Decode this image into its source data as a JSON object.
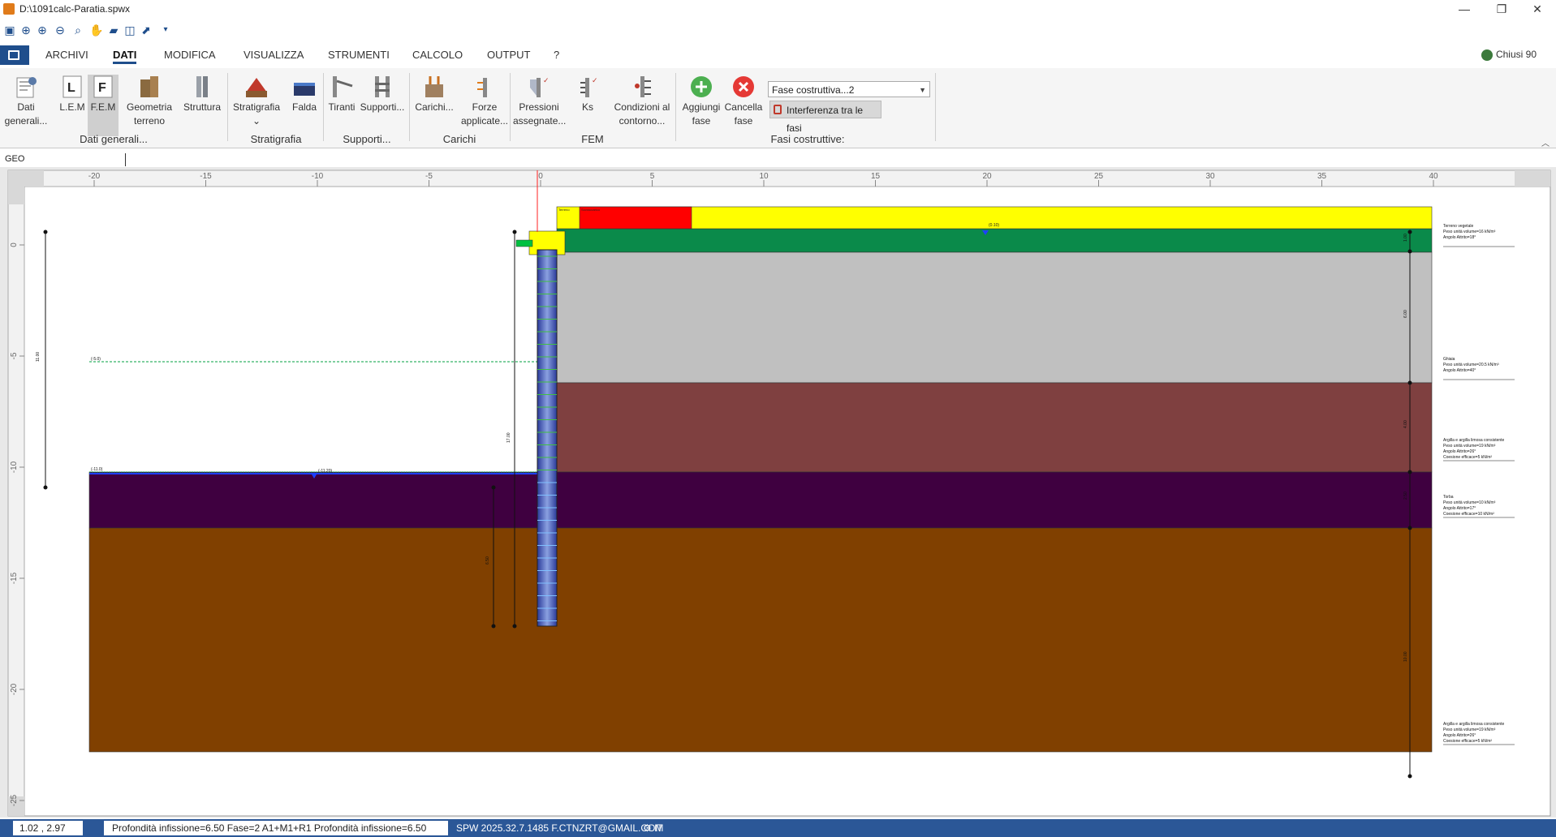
{
  "window": {
    "title": "D:\\1091calc-Paratia.spwx",
    "min_glyph": "—",
    "max_glyph": "❐",
    "close_glyph": "✕"
  },
  "menu": {
    "tabs": [
      "ARCHIVI",
      "DATI",
      "MODIFICA",
      "VISUALIZZA",
      "STRUMENTI",
      "CALCOLO",
      "OUTPUT",
      "?"
    ],
    "active": "DATI",
    "user": "Chiusi 90"
  },
  "ribbon": {
    "buttons": [
      {
        "line1": "Dati",
        "line2": "generali...",
        "icon": "general-data-icon"
      },
      {
        "line1": "L.E.M",
        "line2": "",
        "icon": "lem-icon"
      },
      {
        "line1": "F.E.M",
        "line2": "",
        "icon": "fem-icon"
      },
      {
        "line1": "Geometria",
        "line2": "terreno",
        "icon": "terrain-geometry-icon"
      },
      {
        "line1": "Struttura",
        "line2": "",
        "icon": "structure-icon"
      },
      {
        "line1": "Stratigrafia",
        "line2": "⌄",
        "icon": "stratigraphy-icon"
      },
      {
        "line1": "Falda",
        "line2": "",
        "icon": "water-table-icon"
      },
      {
        "line1": "Tiranti",
        "line2": "",
        "icon": "anchor-icon"
      },
      {
        "line1": "Supporti...",
        "line2": "",
        "icon": "supports-icon"
      },
      {
        "line1": "Carichi...",
        "line2": "",
        "icon": "loads-icon"
      },
      {
        "line1": "Forze",
        "line2": "applicate...",
        "icon": "forces-icon"
      },
      {
        "line1": "Pressioni",
        "line2": "assegnate...",
        "icon": "pressures-icon"
      },
      {
        "line1": "Ks",
        "line2": "",
        "icon": "ks-icon"
      },
      {
        "line1": "Condizioni al",
        "line2": "contorno...",
        "icon": "boundary-conditions-icon"
      },
      {
        "line1": "Aggiungi",
        "line2": "fase",
        "icon": "add-phase-icon"
      },
      {
        "line1": "Cancella",
        "line2": "fase",
        "icon": "delete-phase-icon"
      }
    ],
    "groups": [
      "Dati generali...",
      "Stratigrafia",
      "Supporti...",
      "Carichi",
      "FEM",
      "Fasi costruttive:"
    ],
    "phase_select": "Fase costruttiva...2",
    "interference_label": "Interferenza tra le fasi"
  },
  "geo_tab": "GEO",
  "drawing": {
    "top_ticks": [
      "-20",
      "-15",
      "-10",
      "-5",
      "0",
      "5",
      "10",
      "15",
      "20",
      "25",
      "30",
      "35",
      "40"
    ],
    "left_ticks": [
      "0",
      "-5",
      "-10",
      "-15",
      "-20",
      "-25"
    ],
    "top_soil_labels": [
      "Terreno",
      "Sovraccarico"
    ],
    "water_level_label": "(0.10)",
    "excavation_label": "(-5.0)",
    "excavation_bottom_label": "(-11.0)",
    "excavation_water_label": "(-11.20)",
    "left_dim_label": "11.00",
    "wall_dims": [
      "17.00",
      "6.50"
    ],
    "right_dims": [
      "1.00",
      "6.00",
      "4.00",
      "2.50",
      "10.00"
    ],
    "layers": [
      {
        "name": "Terreno vegetale",
        "lines": [
          "Terreno vegetale",
          "Peso unità volume=16 kN/m³",
          "Angolo Attrito=18°"
        ],
        "color": "#0a8a4a"
      },
      {
        "name": "Ghiaia",
        "lines": [
          "Ghiaia",
          "Peso unità volume=20.5 kN/m³",
          "Angolo Attrito=40°"
        ],
        "color": "#c0c0c0"
      },
      {
        "name": "Argilla",
        "lines": [
          "Argilla e argilla limosa consistente",
          "Peso unità volume=19 kN/m³",
          "Angolo Attrito=26°",
          "Coesione efficace=5 kN/m²"
        ],
        "color": "#7f4040"
      },
      {
        "name": "Torba",
        "lines": [
          "Torba",
          "Peso unità volume=10 kN/m³",
          "Angolo Attrito=17°",
          "Coesione efficace=10 kN/m²"
        ],
        "color": "#3f0040"
      },
      {
        "name": "Argilla2",
        "lines": [
          "Argilla e argilla limosa consistente",
          "Peso unità volume=19 kN/m³",
          "Angolo Attrito=26°",
          "Coesione efficace=5 kN/m²"
        ],
        "color": "#804000"
      }
    ],
    "colors": {
      "surcharge_red": "#ff0000",
      "ground_yellow": "#ffff00",
      "wall_blue": "#4a5ab8"
    }
  },
  "status": {
    "coords": "1.02 , 2.97",
    "info": "Profondità infissione=6.50 Fase=2  A1+M1+R1  Profondità infissione=6.50",
    "version": "SPW 2025.32.7.1485 F.CTNZRT@GMAIL.COM",
    "lang": "IT"
  }
}
